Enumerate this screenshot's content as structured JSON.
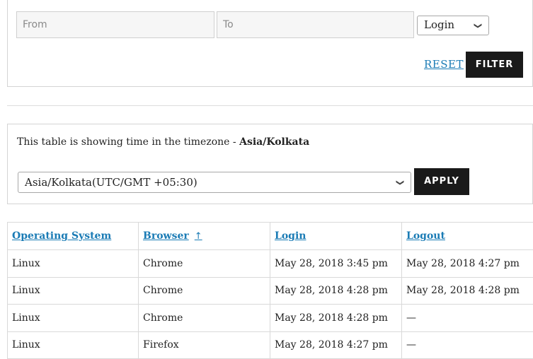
{
  "filter": {
    "from_placeholder": "From",
    "to_placeholder": "To",
    "event_select_value": "Login",
    "reset_label": "RESET",
    "filter_label": "FILTER"
  },
  "timezone": {
    "message_prefix": "This table is showing time in the timezone - ",
    "current_zone": "Asia/Kolkata",
    "select_value": "Asia/Kolkata(UTC/GMT +05:30)",
    "apply_label": "APPLY"
  },
  "table": {
    "columns": [
      {
        "label": "Operating System",
        "arrow": ""
      },
      {
        "label": "Browser",
        "arrow": "↑"
      },
      {
        "label": "Login",
        "arrow": ""
      },
      {
        "label": "Logout",
        "arrow": ""
      }
    ],
    "rows": [
      [
        "Linux",
        "Chrome",
        "May 28, 2018 3:45 pm",
        "May 28, 2018 4:27 pm"
      ],
      [
        "Linux",
        "Chrome",
        "May 28, 2018 4:28 pm",
        "May 28, 2018 4:28 pm"
      ],
      [
        "Linux",
        "Chrome",
        "May 28, 2018 4:28 pm",
        "—"
      ],
      [
        "Linux",
        "Firefox",
        "May 28, 2018 4:27 pm",
        "—"
      ]
    ]
  },
  "icons": {
    "select_chevron": "chevron-down-icon",
    "sort_arrow": "arrow-up-icon"
  },
  "colors": {
    "link": "#1a7bb5",
    "button_bg": "#1a1a1a"
  }
}
